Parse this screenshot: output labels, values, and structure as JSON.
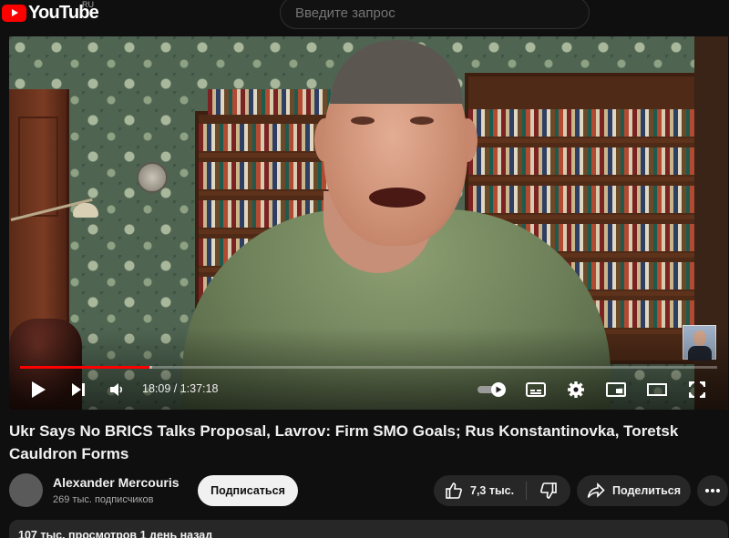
{
  "header": {
    "logo_text": "YouTube",
    "region": "RU",
    "search_placeholder": "Введите запрос"
  },
  "player": {
    "current_time": "18:09",
    "separator": " / ",
    "duration": "1:37:18",
    "progress_fraction": 0.186,
    "loaded_fraction": 0.19,
    "accent_color": "#ff0000",
    "icons": [
      "play-icon",
      "next-icon",
      "volume-icon",
      "autoplay-toggle",
      "subtitles-icon",
      "settings-gear-icon",
      "miniplayer-icon",
      "theater-mode-icon",
      "fullscreen-icon"
    ]
  },
  "video": {
    "title": "Ukr Says No BRICS Talks Proposal, Lavrov: Firm SMO Goals; Rus Konstantinovka, Toretsk Cauldron Forms"
  },
  "channel": {
    "name": "Alexander Mercouris",
    "subscribers": "269 тыс. подписчиков",
    "subscribe_label": "Подписаться"
  },
  "actions": {
    "like_count": "7,3 тыс.",
    "share_label": "Поделиться"
  },
  "description": {
    "meta": "107 тыс. просмотров  1 день назад"
  }
}
